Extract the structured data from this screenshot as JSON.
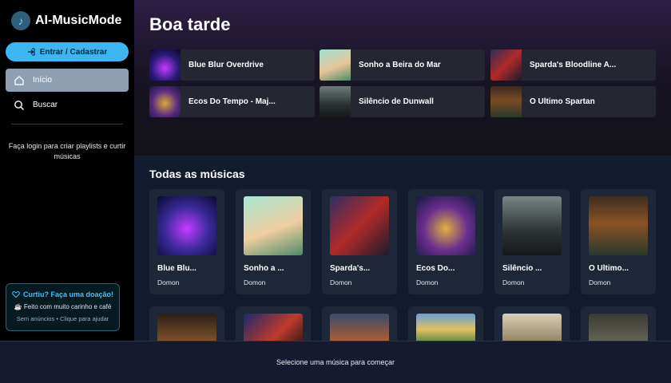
{
  "app": {
    "name": "AI-MusicMode"
  },
  "sidebar": {
    "login_button": "Entrar / Cadastrar",
    "nav": [
      {
        "label": "Início",
        "icon": "home-icon"
      },
      {
        "label": "Buscar",
        "icon": "search-icon"
      }
    ],
    "login_hint": "Faça login para criar playlists e curtir músicas",
    "donation": {
      "title": "Curtiu? Faça uma doação!",
      "subtitle": "Feito com muito carinho e café",
      "note": "Sem anúncios • Clique para ajudar"
    }
  },
  "main": {
    "greeting": "Boa tarde",
    "quick_picks": [
      {
        "label": "Blue Blur Overdrive"
      },
      {
        "label": "Sonho a Beira do Mar"
      },
      {
        "label": "Sparda's Bloodline A..."
      },
      {
        "label": "Ecos Do Tempo - Maj..."
      },
      {
        "label": "Silêncio de Dunwall"
      },
      {
        "label": "O Ultimo Spartan"
      }
    ],
    "section_title": "Todas as músicas",
    "songs": [
      {
        "title": "Blue Blu...",
        "artist": "Domon"
      },
      {
        "title": "Sonho a ...",
        "artist": "Domon"
      },
      {
        "title": "Sparda's...",
        "artist": "Domon"
      },
      {
        "title": "Ecos Do...",
        "artist": "Domon"
      },
      {
        "title": "Silêncio ...",
        "artist": "Domon"
      },
      {
        "title": "O Ultimo...",
        "artist": "Domon"
      }
    ]
  },
  "player": {
    "message": "Selecione uma música para começar"
  },
  "colors": {
    "accent": "#3bb6f0",
    "sidebar_bg": "#000000",
    "card_bg": "#1e2738"
  }
}
